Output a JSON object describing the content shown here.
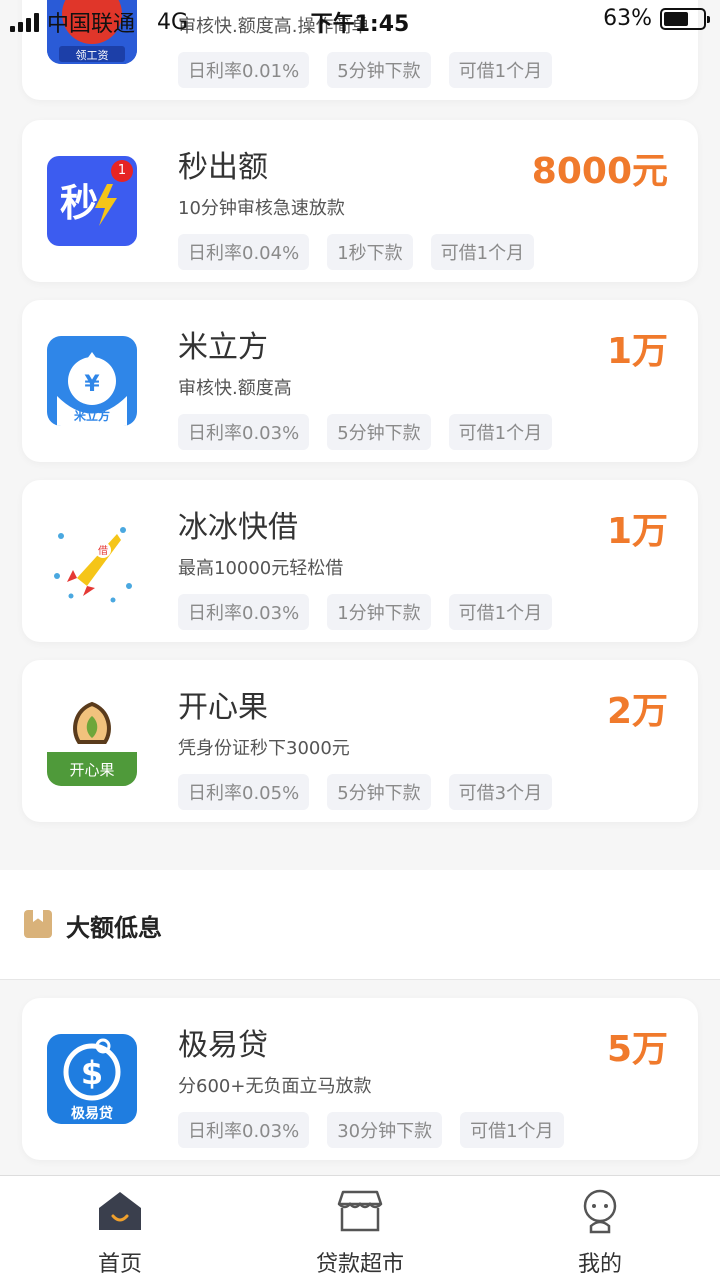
{
  "status_bar": {
    "carrier": "中国联通",
    "network": "4G",
    "time": "下午1:45",
    "battery_percent": "63%",
    "battery_level": 0.63
  },
  "top_partial_card": {
    "logo_text": "领工资",
    "desc": "审核快.额度高.操作简单",
    "tags": [
      "日利率0.01%",
      "5分钟下款",
      "可借1个月"
    ]
  },
  "products": [
    {
      "name": "秒出额",
      "desc": "10分钟审核急速放款",
      "amount": "8000元",
      "logo": "miao-logo",
      "logo_text": "秒",
      "badge": "1",
      "tags": [
        "日利率0.04%",
        "1秒下款",
        "可借1个月"
      ]
    },
    {
      "name": "米立方",
      "desc": "审核快.额度高",
      "amount": "1万",
      "logo": "milifang-logo",
      "logo_text": "米立方",
      "tags": [
        "日利率0.03%",
        "5分钟下款",
        "可借1个月"
      ]
    },
    {
      "name": "冰冰快借",
      "desc": "最高10000元轻松借",
      "amount": "1万",
      "logo": "rocket-logo",
      "logo_text": "借",
      "tags": [
        "日利率0.03%",
        "1分钟下款",
        "可借1个月"
      ]
    },
    {
      "name": "开心果",
      "desc": "凭身份证秒下3000元",
      "amount": "2万",
      "logo": "pistachio-logo",
      "logo_text": "开心果",
      "tags": [
        "日利率0.05%",
        "5分钟下款",
        "可借3个月"
      ]
    }
  ],
  "section": {
    "title": "大额低息"
  },
  "section_products": [
    {
      "name": "极易贷",
      "desc": "分600+无负面立马放款",
      "amount": "5万",
      "logo": "jiyidai-logo",
      "logo_text": "极易贷",
      "tags": [
        "日利率0.03%",
        "30分钟下款",
        "可借1个月"
      ]
    }
  ],
  "tabbar": {
    "home": "首页",
    "market": "贷款超市",
    "mine": "我的"
  },
  "colors": {
    "accent": "#f07a2c",
    "tag_bg": "#f2f3f7",
    "section_icon": "#d9b27a"
  }
}
